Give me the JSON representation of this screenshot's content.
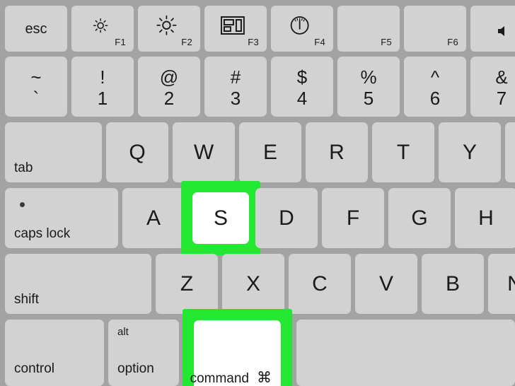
{
  "image": {
    "subject": "mac-keyboard-shortcut-illustration",
    "shortcut_keys": [
      "S",
      "command"
    ],
    "highlight_color": "#22e832",
    "keycap_color": "#d2d2d2",
    "background_color": "#a3a3a3",
    "highlighted_keycap_color": "#ffffff"
  },
  "rows": {
    "function_row": [
      {
        "name": "esc",
        "label": "esc",
        "icon": "",
        "fn": ""
      },
      {
        "name": "f1",
        "label": "",
        "icon": "brightness-down-icon",
        "fn": "F1"
      },
      {
        "name": "f2",
        "label": "",
        "icon": "brightness-up-icon",
        "fn": "F2"
      },
      {
        "name": "f3",
        "label": "",
        "icon": "mission-control-icon",
        "fn": "F3"
      },
      {
        "name": "f4",
        "label": "",
        "icon": "dashboard-gauge-icon",
        "fn": "F4"
      },
      {
        "name": "f5",
        "label": "",
        "icon": "",
        "fn": "F5"
      },
      {
        "name": "f6",
        "label": "",
        "icon": "",
        "fn": "F6"
      },
      {
        "name": "f7",
        "label": "",
        "icon": "volume-icon",
        "fn": ""
      }
    ],
    "number_row": [
      {
        "name": "tilde",
        "upper": "~",
        "lower": "`"
      },
      {
        "name": "one",
        "upper": "!",
        "lower": "1"
      },
      {
        "name": "two",
        "upper": "@",
        "lower": "2"
      },
      {
        "name": "three",
        "upper": "#",
        "lower": "3"
      },
      {
        "name": "four",
        "upper": "$",
        "lower": "4"
      },
      {
        "name": "five",
        "upper": "%",
        "lower": "5"
      },
      {
        "name": "six",
        "upper": "^",
        "lower": "6"
      },
      {
        "name": "seven",
        "upper": "&",
        "lower": "7"
      }
    ],
    "qwerty_row": {
      "modifier": "tab",
      "letters": [
        "Q",
        "W",
        "E",
        "R",
        "T",
        "Y"
      ]
    },
    "home_row": {
      "modifier": "caps lock",
      "letters": [
        "A",
        "S",
        "D",
        "F",
        "G",
        "H"
      ]
    },
    "bottom_letter_row": {
      "modifier": "shift",
      "letters": [
        "Z",
        "X",
        "C",
        "V",
        "B",
        "N"
      ]
    },
    "modifier_row": {
      "control": "control",
      "option_alt": "alt",
      "option": "option",
      "command": "command",
      "command_glyph": "⌘",
      "spacebar": ""
    }
  }
}
